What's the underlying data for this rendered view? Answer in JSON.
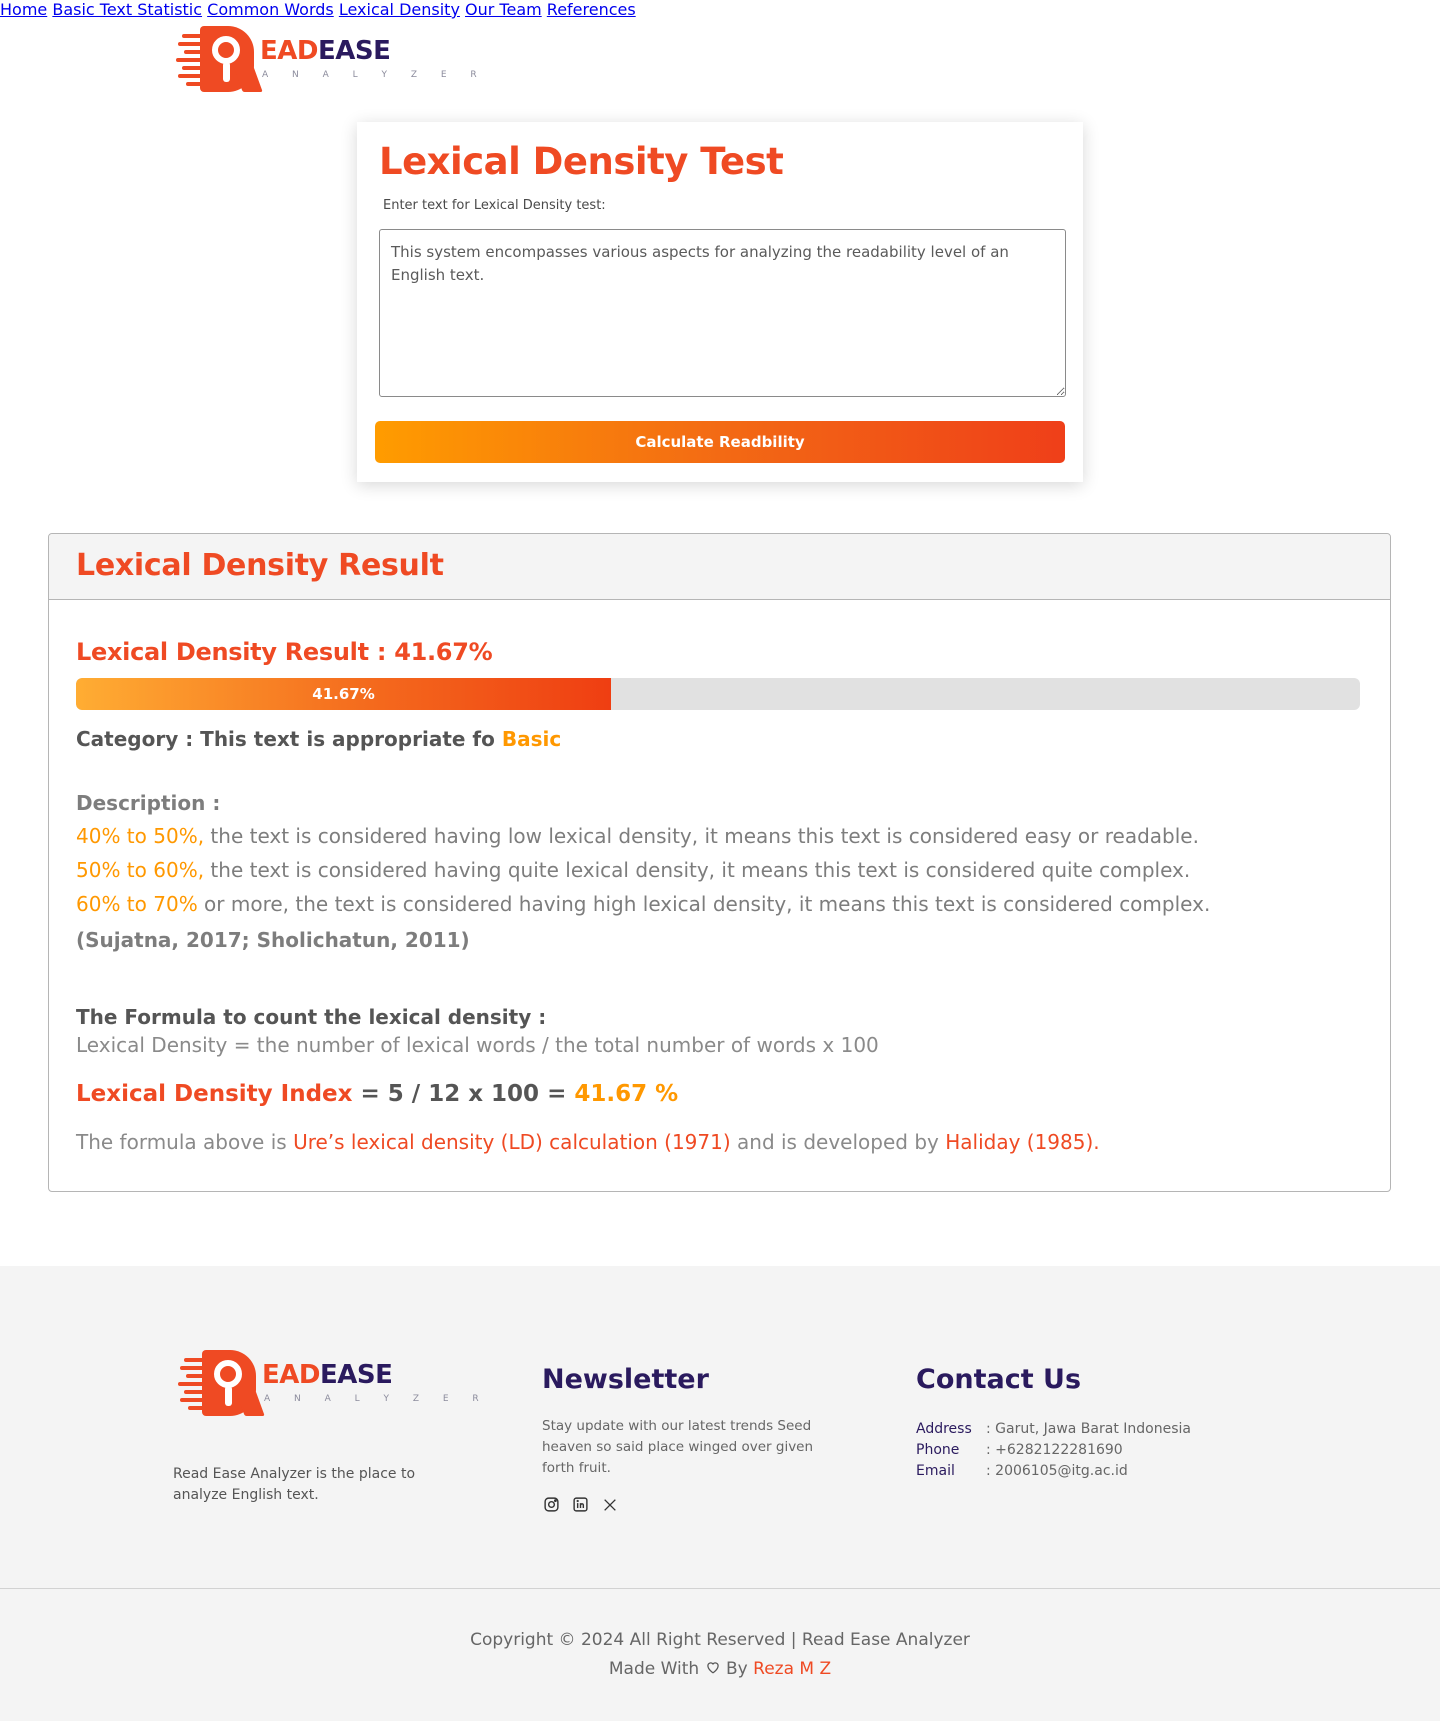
{
  "brand": {
    "name_part1": "EAD",
    "name_part2": "EASE",
    "tagline": "A N A L Y Z E R"
  },
  "nav": [
    "Home",
    "Basic Text Statistic",
    "Common Words",
    "Lexical Density",
    "Our Team",
    "References"
  ],
  "test_card": {
    "title": "Lexical Density Test",
    "label": "Enter text for Lexical Density test:",
    "text_value": "This system encompasses various aspects for analyzing the readability level of an English text.",
    "button_label": "Calculate Readbility"
  },
  "result": {
    "heading": "Lexical Density Result",
    "score_label": "Lexical Density Result : 41.67%",
    "progress_percent": 41.67,
    "progress_label": "41.67%",
    "category_prefix": "Category : This text is appropriate fo",
    "category_value": "Basic",
    "description_title": "Description :",
    "descriptions": [
      {
        "range": "40% to 50%,",
        "text": " the text is considered having low lexical density, it means this text is considered easy or readable."
      },
      {
        "range": "50% to 60%,",
        "text": " the text is considered having quite lexical density, it means this text is considered quite complex."
      },
      {
        "range": "60% to 70%",
        "text": " or more, the text is considered having high lexical density, it means this text is considered complex."
      }
    ],
    "citation": "(Sujatna, 2017; Sholichatun, 2011)",
    "formula_title": "The Formula to count the lexical density :",
    "formula": "Lexical Density = the number of lexical words / the total number of words x 100",
    "index_label": "Lexical Density Index",
    "index_calc": " = 5 / 12 x 100 = ",
    "index_value": "41.67 %",
    "note_prefix": "The formula above is ",
    "note_link1": "Ure’s lexical density (LD) calculation (1971)",
    "note_mid": " and is developed by ",
    "note_link2": "Haliday (1985)."
  },
  "footer": {
    "about": "Read Ease Analyzer is the place to analyze English text.",
    "newsletter_title": "Newsletter",
    "newsletter_text": "Stay update with our latest trends Seed heaven so said place winged over given forth fruit.",
    "socials": [
      "instagram-icon",
      "linkedin-icon",
      "x-icon"
    ],
    "contact_title": "Contact Us",
    "contact": [
      {
        "key": "Address",
        "value": ": Garut, Jawa Barat Indonesia"
      },
      {
        "key": "Phone",
        "value": " : +6282122281690"
      },
      {
        "key": "Email",
        "value": ": 2006105@itg.ac.id"
      }
    ],
    "copyright": "Copyright © 2024 All Right Reserved | Read Ease Analyzer",
    "made_prefix": "Made With",
    "made_by": "By",
    "author": "Reza M Z"
  },
  "colors": {
    "accent": "#ef4a23",
    "orange": "#ff9800",
    "navy": "#2a1a5e"
  }
}
